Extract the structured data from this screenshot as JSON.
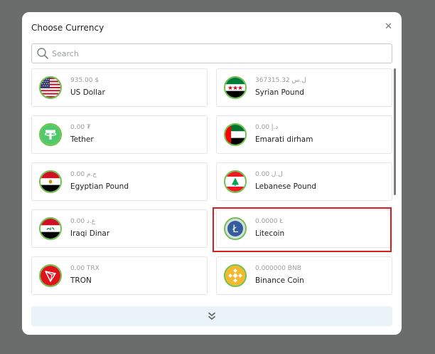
{
  "modal": {
    "title": "Choose Currency",
    "close_icon": "close-icon"
  },
  "search": {
    "placeholder": "Search",
    "value": ""
  },
  "currencies": [
    {
      "amount": "935.00 $",
      "name": "US Dollar",
      "flag": "us-flag-icon"
    },
    {
      "amount": "367315.32 ل.س",
      "name": "Syrian Pound",
      "flag": "syria-flag-icon"
    },
    {
      "amount": "0.00 ₮",
      "name": "Tether",
      "flag": "tether-icon"
    },
    {
      "amount": "0.00 د.إ",
      "name": "Emarati dirham",
      "flag": "uae-flag-icon"
    },
    {
      "amount": "0.00 ج.م",
      "name": "Egyptian Pound",
      "flag": "egypt-flag-icon"
    },
    {
      "amount": "0.00 ل.ل",
      "name": "Lebanese Pound",
      "flag": "lebanon-flag-icon"
    },
    {
      "amount": "0.00 ع.د",
      "name": "Iraqi Dinar",
      "flag": "iraq-flag-icon"
    },
    {
      "amount": "0.0000 Ł",
      "name": "Litecoin",
      "flag": "litecoin-icon"
    },
    {
      "amount": "0.00 TRX",
      "name": "TRON",
      "flag": "tron-icon"
    },
    {
      "amount": "0.000000 BNB",
      "name": "Binance Coin",
      "flag": "binance-icon"
    }
  ],
  "load_more_icon": "double-chevron-down-icon",
  "colors": {
    "backdrop": "#6b6c6c",
    "card_border": "#e3e6e8",
    "flag_ring": "#6cc24a",
    "load_more_bg": "#eaf4f8",
    "highlight": "#d42020"
  }
}
